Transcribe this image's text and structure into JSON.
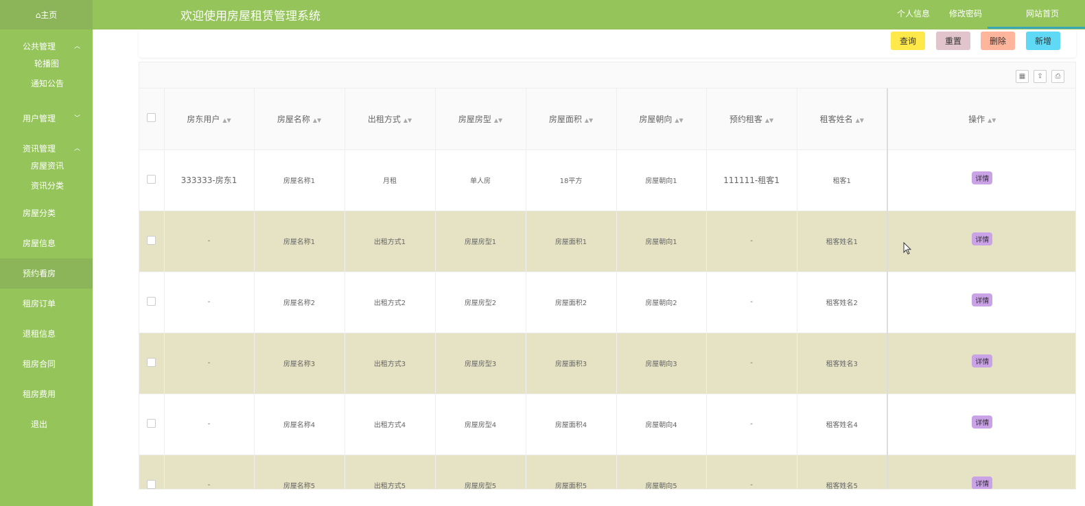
{
  "sidebar": {
    "home": "⌂主页",
    "groups": [
      {
        "title": "公共管理",
        "chevron": "︿",
        "subs": [
          "轮播图",
          "通知公告"
        ]
      },
      {
        "title": "用户管理",
        "chevron": "﹀",
        "subs": []
      },
      {
        "title": "资讯管理",
        "chevron": "︿",
        "subs": [
          "房屋资讯",
          "资讯分类"
        ]
      }
    ],
    "items": [
      "房屋分类",
      "房屋信息",
      "预约看房",
      "租房订单",
      "退租信息",
      "租房合同",
      "租房费用",
      "退出"
    ]
  },
  "topbar": {
    "title": "欢迎使用房屋租赁管理系统",
    "nav": [
      "个人信息",
      "修改密码",
      "网站首页"
    ]
  },
  "actions": {
    "query": "查询",
    "reset": "重置",
    "delete": "删除",
    "add": "新增"
  },
  "colors": {
    "query": "#ffe94a",
    "reset": "#e2c4cc",
    "delete": "#ffb49c",
    "add": "#5fd9f5",
    "sidebar": "#95c45a",
    "row_alt": "#e5e3c4"
  },
  "table": {
    "headers": [
      "房东用户",
      "房屋名称",
      "出租方式",
      "房屋房型",
      "房屋面积",
      "房屋朝向",
      "预约租客",
      "租客姓名",
      "操作"
    ],
    "detail_label": "详情",
    "rows": [
      [
        "333333-房东1",
        "房屋名称1",
        "月租",
        "单人房",
        "18平方",
        "房屋朝向1",
        "111111-租客1",
        "租客1"
      ],
      [
        "-",
        "房屋名称1",
        "出租方式1",
        "房屋房型1",
        "房屋面积1",
        "房屋朝向1",
        "-",
        "租客姓名1"
      ],
      [
        "-",
        "房屋名称2",
        "出租方式2",
        "房屋房型2",
        "房屋面积2",
        "房屋朝向2",
        "-",
        "租客姓名2"
      ],
      [
        "-",
        "房屋名称3",
        "出租方式3",
        "房屋房型3",
        "房屋面积3",
        "房屋朝向3",
        "-",
        "租客姓名3"
      ],
      [
        "-",
        "房屋名称4",
        "出租方式4",
        "房屋房型4",
        "房屋面积4",
        "房屋朝向4",
        "-",
        "租客姓名4"
      ],
      [
        "-",
        "房屋名称5",
        "出租方式5",
        "房屋房型5",
        "房屋面积5",
        "房屋朝向5",
        "-",
        "租客姓名5"
      ]
    ]
  }
}
